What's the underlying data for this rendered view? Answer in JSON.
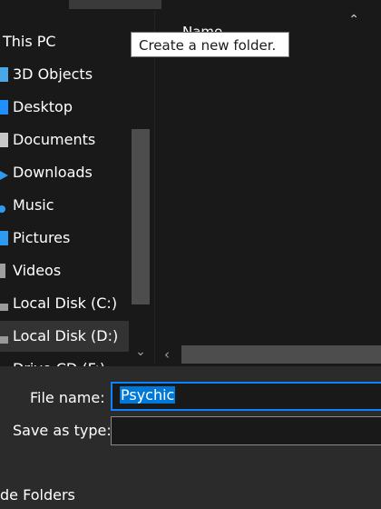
{
  "tooltip": "Create a new folder.",
  "nav": {
    "items": [
      {
        "label": "This PC",
        "icon": "computer-icon",
        "color": "#4aa8e8"
      },
      {
        "label": "3D Objects",
        "icon": "cube-icon",
        "color": "#4aa8e8"
      },
      {
        "label": "Desktop",
        "icon": "desktop-icon",
        "color": "#1e90ff"
      },
      {
        "label": "Documents",
        "icon": "documents-icon",
        "color": "#c8c8c8"
      },
      {
        "label": "Downloads",
        "icon": "download-arrow-icon",
        "color": "#2f9bf0"
      },
      {
        "label": "Music",
        "icon": "music-note-icon",
        "color": "#2f9bf0"
      },
      {
        "label": "Pictures",
        "icon": "pictures-icon",
        "color": "#2f9bf0"
      },
      {
        "label": "Videos",
        "icon": "videos-icon",
        "color": "#a0a0a0"
      },
      {
        "label": "Local Disk (C:)",
        "icon": "drive-icon",
        "color": "#9a9a9a"
      },
      {
        "label": "Local Disk (D:)",
        "icon": "drive-icon",
        "color": "#9a9a9a"
      },
      {
        "label": "Drive CD (F:)",
        "icon": "cd-drive-icon",
        "color": "#9a9a9a"
      }
    ],
    "selected_index": 9
  },
  "file_list": {
    "column_header": "Name"
  },
  "form": {
    "file_name_label": "File name:",
    "file_name_value": "Psychic",
    "save_as_type_label": "Save as type:",
    "save_as_type_value": ""
  },
  "hide_folders_label": "de Folders"
}
